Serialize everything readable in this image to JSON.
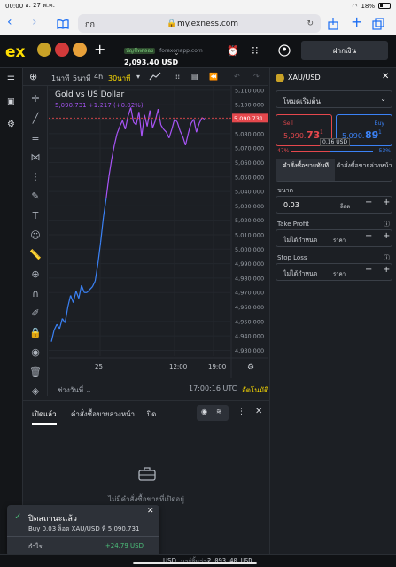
{
  "statusbar": {
    "time": "00:00",
    "date": "อ. 27 พ.ค.",
    "battery": "18%"
  },
  "browser": {
    "tab_label": "กก",
    "url": "my.exness.com"
  },
  "header": {
    "logo": "ex",
    "account_type": "บัญชีทดลอง",
    "server": "forexonapp.com",
    "balance": "2,093.40 USD",
    "deposit_label": "ฝากเงิน"
  },
  "chart_toolbar": {
    "timeframes": [
      "1นาที",
      "5นาที",
      "4h",
      "30นาที"
    ],
    "active_timeframe": "30นาที"
  },
  "chart_data": {
    "type": "line",
    "title": "Gold vs US Dollar",
    "price_line": "5,090.731",
    "change": "+1.217 (+0.02%)",
    "y_ticks": [
      "5,110.000",
      "5,100.000",
      "5,090.000",
      "5,080.000",
      "5,070.000",
      "5,060.000",
      "5,050.000",
      "5,040.000",
      "5,030.000",
      "5,020.000",
      "5,010.000",
      "5,000.000",
      "4,990.000",
      "4,980.000",
      "4,970.000",
      "4,960.000",
      "4,950.000",
      "4,940.000",
      "4,930.000"
    ],
    "x_ticks": [
      "25",
      "12:00",
      "19:00"
    ],
    "ylim": [
      4926,
      5113
    ],
    "current_price_label": "5,090.731",
    "colors": {
      "rising": "#3b82f6",
      "falling": "#a855f7"
    },
    "series": [
      {
        "values": [
          4936,
          4944,
          4948,
          4945,
          4952,
          4949,
          4960,
          4968,
          4963,
          4971,
          4966,
          4975,
          4970,
          4970,
          4972,
          4974,
          4978,
          4990,
          5005,
          5022,
          5035,
          5050,
          5062,
          5072,
          5080,
          5085,
          5089,
          5083,
          5092,
          5098,
          5088,
          5086,
          5095,
          5078,
          5093,
          5085,
          5096,
          5084,
          5089,
          5097,
          5086,
          5083,
          5081,
          5077,
          5083,
          5090,
          5088,
          5082,
          5078,
          5072,
          5080,
          5087,
          5090,
          5081,
          5087,
          5091,
          5090
        ]
      }
    ]
  },
  "chart_bottom": {
    "range_label": "ช่วงวันที่",
    "time": "17:00:16 UTC",
    "auto_label": "อัตโนมัติ"
  },
  "order_panel": {
    "symbol": "XAU/USD",
    "mode": "โหมดเริ่มต้น",
    "sell_label": "Sell",
    "sell_price_main": "5,090.",
    "sell_price_big": "73",
    "sell_price_sup": "1",
    "buy_label": "Buy",
    "buy_price_main": "5,090.",
    "buy_price_big": "89",
    "buy_price_sup": "1",
    "spread": "0.16 USD",
    "sell_pct": "47%",
    "buy_pct": "53%",
    "tab_market": "คำสั่งซื้อขายทันที",
    "tab_pending": "คำสั่งซื้อขายล่วงหน้า",
    "volume_label": "ขนาด",
    "volume_value": "0.03",
    "volume_unit": "ล็อต",
    "tp_label": "Take Profit",
    "tp_value": "ไม่ได้กำหนด",
    "tp_unit": "ราคา",
    "sl_label": "Stop Loss",
    "sl_value": "ไม่ได้กำหนด",
    "sl_unit": "ราคา"
  },
  "bottom_panel": {
    "tab_open": "เปิดแล้ว",
    "tab_pending": "คำสั่งซื้อขายล่วงหน้า",
    "tab_closed": "ปิด",
    "empty_text": "ไม่มีคำสั่งซื้อขายที่เปิดอยู่"
  },
  "toast": {
    "title": "ปิดสถานะแล้ว",
    "detail": "Buy 0.03 ล็อต XAU/USD ที่ 5,090.731",
    "profit_label": "กำไร",
    "profit_value": "+24.79 USD"
  },
  "footer": {
    "left_unit": "USD",
    "margin_label": "มาร์จิ้นว่าง",
    "margin_value": "2,093.40 USD"
  }
}
